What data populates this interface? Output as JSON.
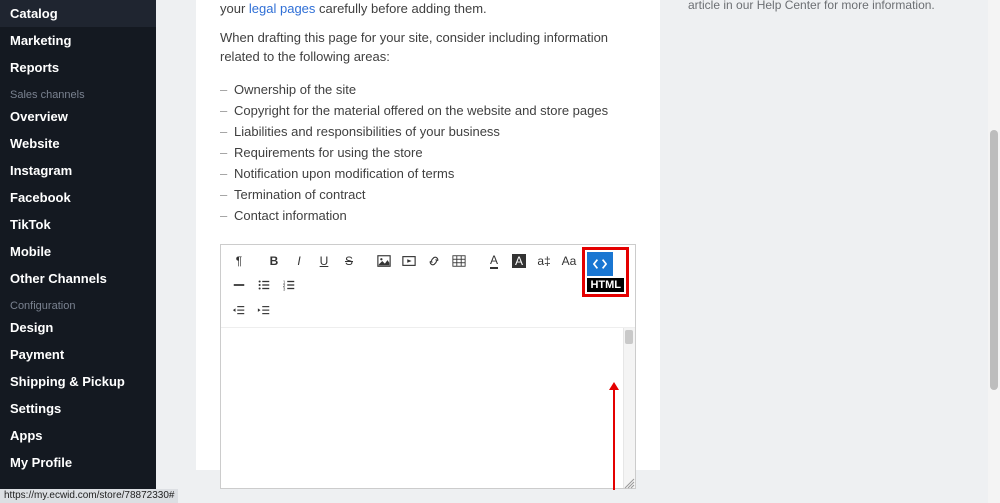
{
  "sidebar": {
    "top": [
      {
        "label": "Catalog"
      },
      {
        "label": "Marketing"
      },
      {
        "label": "Reports"
      }
    ],
    "sections": [
      {
        "title": "Sales channels",
        "items": [
          {
            "label": "Overview"
          },
          {
            "label": "Website"
          },
          {
            "label": "Instagram"
          },
          {
            "label": "Facebook"
          },
          {
            "label": "TikTok"
          },
          {
            "label": "Mobile"
          },
          {
            "label": "Other Channels"
          }
        ]
      },
      {
        "title": "Configuration",
        "items": [
          {
            "label": "Design"
          },
          {
            "label": "Payment"
          },
          {
            "label": "Shipping & Pickup"
          },
          {
            "label": "Settings"
          },
          {
            "label": "Apps"
          },
          {
            "label": "My Profile"
          }
        ]
      }
    ]
  },
  "content": {
    "intro_prefix": "your ",
    "intro_link": "legal pages",
    "intro_suffix": " carefully before adding them.",
    "intro2": "When drafting this page for your site, consider including information related to the following areas:",
    "bullets": [
      "Ownership of the site",
      "Copyright for the material offered on the website and store pages",
      "Liabilities and responsibilities of your business",
      "Requirements for using the store",
      "Notification upon modification of terms",
      "Termination of contract",
      "Contact information"
    ]
  },
  "editor": {
    "html_tooltip": "HTML",
    "toolbar": {
      "paragraph": "¶",
      "bold": "B",
      "italic": "I",
      "underline": "U",
      "strike": "S",
      "fontcolor": "A",
      "fontsize": "a‡",
      "textcase": "Aa"
    }
  },
  "help": {
    "text": "article in our Help Center for more information."
  },
  "status_bar": "https://my.ecwid.com/store/78872330#"
}
